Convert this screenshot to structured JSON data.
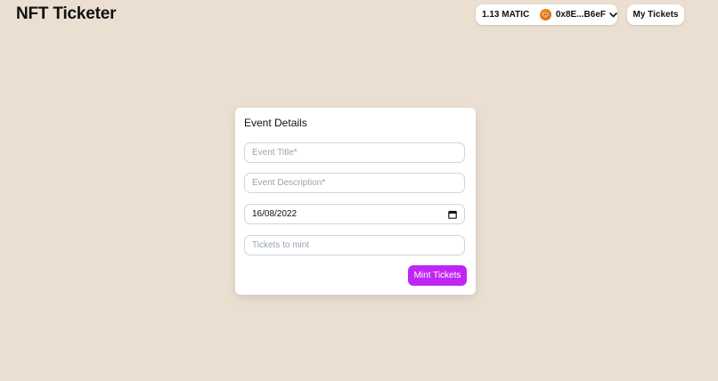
{
  "header": {
    "title": "NFT Ticketer",
    "wallet": {
      "balance": "1.13 MATIC",
      "address": "0x8E...B6eF",
      "avatar_icon": "fox-avatar-icon",
      "chevron_icon": "chevron-down-icon"
    },
    "my_tickets_label": "My Tickets"
  },
  "form": {
    "heading": "Event Details",
    "fields": [
      {
        "placeholder": "Event Title*",
        "value": ""
      },
      {
        "placeholder": "Event Description*",
        "value": ""
      },
      {
        "value": "16/08/2022",
        "icon": "calendar-icon"
      },
      {
        "placeholder": "Tickets to mint",
        "value": ""
      }
    ],
    "submit_label": "Mint Tickets"
  },
  "colors": {
    "background": "#ebdfd2",
    "accent": "#c026f3",
    "card": "#ffffff"
  }
}
